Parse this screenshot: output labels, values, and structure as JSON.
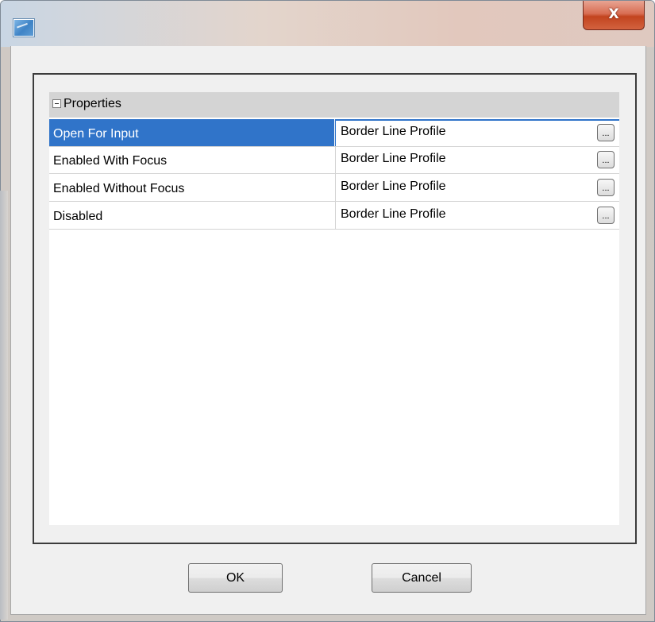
{
  "window": {
    "title": "",
    "close_label": "X"
  },
  "properties": {
    "category_label": "Properties",
    "rows": [
      {
        "name": "Open For Input",
        "value": "Border Line Profile",
        "button": "...",
        "selected": true
      },
      {
        "name": "Enabled With Focus",
        "value": "Border Line Profile",
        "button": "...",
        "selected": false
      },
      {
        "name": "Enabled Without Focus",
        "value": "Border Line Profile",
        "button": "...",
        "selected": false
      },
      {
        "name": "Disabled",
        "value": "Border Line Profile",
        "button": "...",
        "selected": false
      }
    ]
  },
  "footer": {
    "ok_label": "OK",
    "cancel_label": "Cancel"
  },
  "colors": {
    "selection": "#3074c9",
    "category_bg": "#d4d4d4",
    "close_button": "#c2441f"
  },
  "icons": {
    "app": "app-icon",
    "collapse": "collapse-minus-icon"
  }
}
